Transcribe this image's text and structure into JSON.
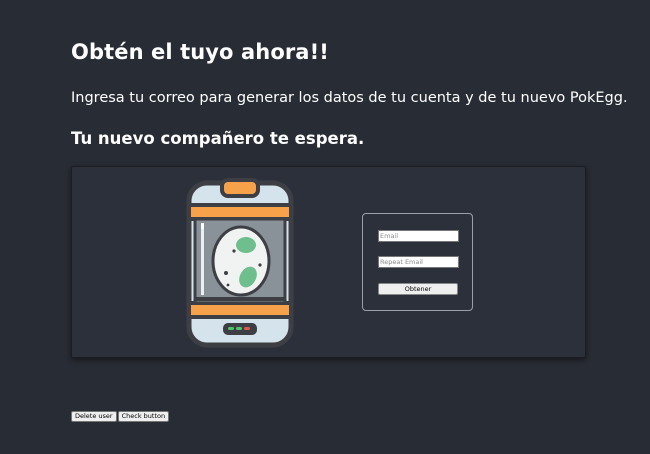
{
  "page": {
    "title": "Obtén el tuyo ahora!!",
    "intro": "Ingresa tu correo para generar los datos de tu cuenta y de tu nuevo PokEgg.",
    "subtitle": "Tu nuevo compañero te espera."
  },
  "illustration": {
    "icon": "egg-incubator-icon",
    "colors": {
      "body": "#d4e3ec",
      "outline": "#3d3f44",
      "band": "#f7a24a",
      "egg_spots": "#6fbf8e",
      "led_green": "#4fc46a",
      "led_red": "#e0574f"
    }
  },
  "form": {
    "email_placeholder": "Email",
    "repeat_placeholder": "Repeat Email",
    "submit_label": "Obtener"
  },
  "footer": {
    "delete_label": "Delete user",
    "check_label": "Check button"
  }
}
